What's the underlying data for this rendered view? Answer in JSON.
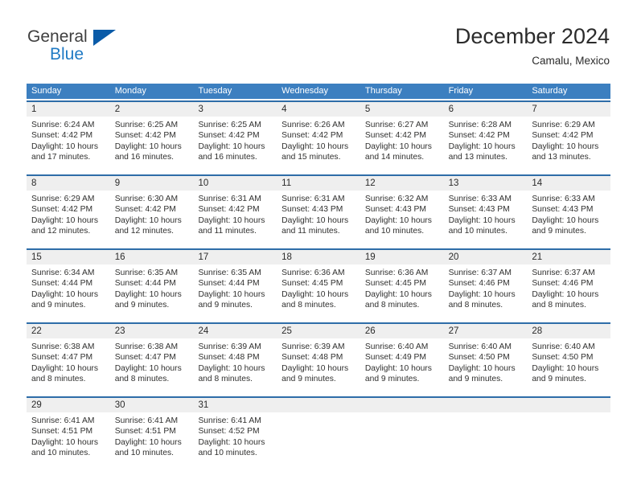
{
  "brand": {
    "name_part1": "General",
    "name_part2": "Blue",
    "triangle_color": "#0a5ba8",
    "blue_color": "#1f7ac4"
  },
  "header": {
    "title": "December 2024",
    "location": "Camalu, Mexico"
  },
  "theme": {
    "header_bar": "#3c7fc0",
    "week_rule": "#2e6da8",
    "daynum_bg": "#efefef",
    "text": "#30302f"
  },
  "weekdays": [
    "Sunday",
    "Monday",
    "Tuesday",
    "Wednesday",
    "Thursday",
    "Friday",
    "Saturday"
  ],
  "weeks": [
    [
      {
        "day": "1",
        "l1": "Sunrise: 6:24 AM",
        "l2": "Sunset: 4:42 PM",
        "l3": "Daylight: 10 hours",
        "l4": "and 17 minutes."
      },
      {
        "day": "2",
        "l1": "Sunrise: 6:25 AM",
        "l2": "Sunset: 4:42 PM",
        "l3": "Daylight: 10 hours",
        "l4": "and 16 minutes."
      },
      {
        "day": "3",
        "l1": "Sunrise: 6:25 AM",
        "l2": "Sunset: 4:42 PM",
        "l3": "Daylight: 10 hours",
        "l4": "and 16 minutes."
      },
      {
        "day": "4",
        "l1": "Sunrise: 6:26 AM",
        "l2": "Sunset: 4:42 PM",
        "l3": "Daylight: 10 hours",
        "l4": "and 15 minutes."
      },
      {
        "day": "5",
        "l1": "Sunrise: 6:27 AM",
        "l2": "Sunset: 4:42 PM",
        "l3": "Daylight: 10 hours",
        "l4": "and 14 minutes."
      },
      {
        "day": "6",
        "l1": "Sunrise: 6:28 AM",
        "l2": "Sunset: 4:42 PM",
        "l3": "Daylight: 10 hours",
        "l4": "and 13 minutes."
      },
      {
        "day": "7",
        "l1": "Sunrise: 6:29 AM",
        "l2": "Sunset: 4:42 PM",
        "l3": "Daylight: 10 hours",
        "l4": "and 13 minutes."
      }
    ],
    [
      {
        "day": "8",
        "l1": "Sunrise: 6:29 AM",
        "l2": "Sunset: 4:42 PM",
        "l3": "Daylight: 10 hours",
        "l4": "and 12 minutes."
      },
      {
        "day": "9",
        "l1": "Sunrise: 6:30 AM",
        "l2": "Sunset: 4:42 PM",
        "l3": "Daylight: 10 hours",
        "l4": "and 12 minutes."
      },
      {
        "day": "10",
        "l1": "Sunrise: 6:31 AM",
        "l2": "Sunset: 4:42 PM",
        "l3": "Daylight: 10 hours",
        "l4": "and 11 minutes."
      },
      {
        "day": "11",
        "l1": "Sunrise: 6:31 AM",
        "l2": "Sunset: 4:43 PM",
        "l3": "Daylight: 10 hours",
        "l4": "and 11 minutes."
      },
      {
        "day": "12",
        "l1": "Sunrise: 6:32 AM",
        "l2": "Sunset: 4:43 PM",
        "l3": "Daylight: 10 hours",
        "l4": "and 10 minutes."
      },
      {
        "day": "13",
        "l1": "Sunrise: 6:33 AM",
        "l2": "Sunset: 4:43 PM",
        "l3": "Daylight: 10 hours",
        "l4": "and 10 minutes."
      },
      {
        "day": "14",
        "l1": "Sunrise: 6:33 AM",
        "l2": "Sunset: 4:43 PM",
        "l3": "Daylight: 10 hours",
        "l4": "and 9 minutes."
      }
    ],
    [
      {
        "day": "15",
        "l1": "Sunrise: 6:34 AM",
        "l2": "Sunset: 4:44 PM",
        "l3": "Daylight: 10 hours",
        "l4": "and 9 minutes."
      },
      {
        "day": "16",
        "l1": "Sunrise: 6:35 AM",
        "l2": "Sunset: 4:44 PM",
        "l3": "Daylight: 10 hours",
        "l4": "and 9 minutes."
      },
      {
        "day": "17",
        "l1": "Sunrise: 6:35 AM",
        "l2": "Sunset: 4:44 PM",
        "l3": "Daylight: 10 hours",
        "l4": "and 9 minutes."
      },
      {
        "day": "18",
        "l1": "Sunrise: 6:36 AM",
        "l2": "Sunset: 4:45 PM",
        "l3": "Daylight: 10 hours",
        "l4": "and 8 minutes."
      },
      {
        "day": "19",
        "l1": "Sunrise: 6:36 AM",
        "l2": "Sunset: 4:45 PM",
        "l3": "Daylight: 10 hours",
        "l4": "and 8 minutes."
      },
      {
        "day": "20",
        "l1": "Sunrise: 6:37 AM",
        "l2": "Sunset: 4:46 PM",
        "l3": "Daylight: 10 hours",
        "l4": "and 8 minutes."
      },
      {
        "day": "21",
        "l1": "Sunrise: 6:37 AM",
        "l2": "Sunset: 4:46 PM",
        "l3": "Daylight: 10 hours",
        "l4": "and 8 minutes."
      }
    ],
    [
      {
        "day": "22",
        "l1": "Sunrise: 6:38 AM",
        "l2": "Sunset: 4:47 PM",
        "l3": "Daylight: 10 hours",
        "l4": "and 8 minutes."
      },
      {
        "day": "23",
        "l1": "Sunrise: 6:38 AM",
        "l2": "Sunset: 4:47 PM",
        "l3": "Daylight: 10 hours",
        "l4": "and 8 minutes."
      },
      {
        "day": "24",
        "l1": "Sunrise: 6:39 AM",
        "l2": "Sunset: 4:48 PM",
        "l3": "Daylight: 10 hours",
        "l4": "and 8 minutes."
      },
      {
        "day": "25",
        "l1": "Sunrise: 6:39 AM",
        "l2": "Sunset: 4:48 PM",
        "l3": "Daylight: 10 hours",
        "l4": "and 9 minutes."
      },
      {
        "day": "26",
        "l1": "Sunrise: 6:40 AM",
        "l2": "Sunset: 4:49 PM",
        "l3": "Daylight: 10 hours",
        "l4": "and 9 minutes."
      },
      {
        "day": "27",
        "l1": "Sunrise: 6:40 AM",
        "l2": "Sunset: 4:50 PM",
        "l3": "Daylight: 10 hours",
        "l4": "and 9 minutes."
      },
      {
        "day": "28",
        "l1": "Sunrise: 6:40 AM",
        "l2": "Sunset: 4:50 PM",
        "l3": "Daylight: 10 hours",
        "l4": "and 9 minutes."
      }
    ],
    [
      {
        "day": "29",
        "l1": "Sunrise: 6:41 AM",
        "l2": "Sunset: 4:51 PM",
        "l3": "Daylight: 10 hours",
        "l4": "and 10 minutes."
      },
      {
        "day": "30",
        "l1": "Sunrise: 6:41 AM",
        "l2": "Sunset: 4:51 PM",
        "l3": "Daylight: 10 hours",
        "l4": "and 10 minutes."
      },
      {
        "day": "31",
        "l1": "Sunrise: 6:41 AM",
        "l2": "Sunset: 4:52 PM",
        "l3": "Daylight: 10 hours",
        "l4": "and 10 minutes."
      },
      {
        "day": "",
        "l1": "",
        "l2": "",
        "l3": "",
        "l4": ""
      },
      {
        "day": "",
        "l1": "",
        "l2": "",
        "l3": "",
        "l4": ""
      },
      {
        "day": "",
        "l1": "",
        "l2": "",
        "l3": "",
        "l4": ""
      },
      {
        "day": "",
        "l1": "",
        "l2": "",
        "l3": "",
        "l4": ""
      }
    ]
  ]
}
